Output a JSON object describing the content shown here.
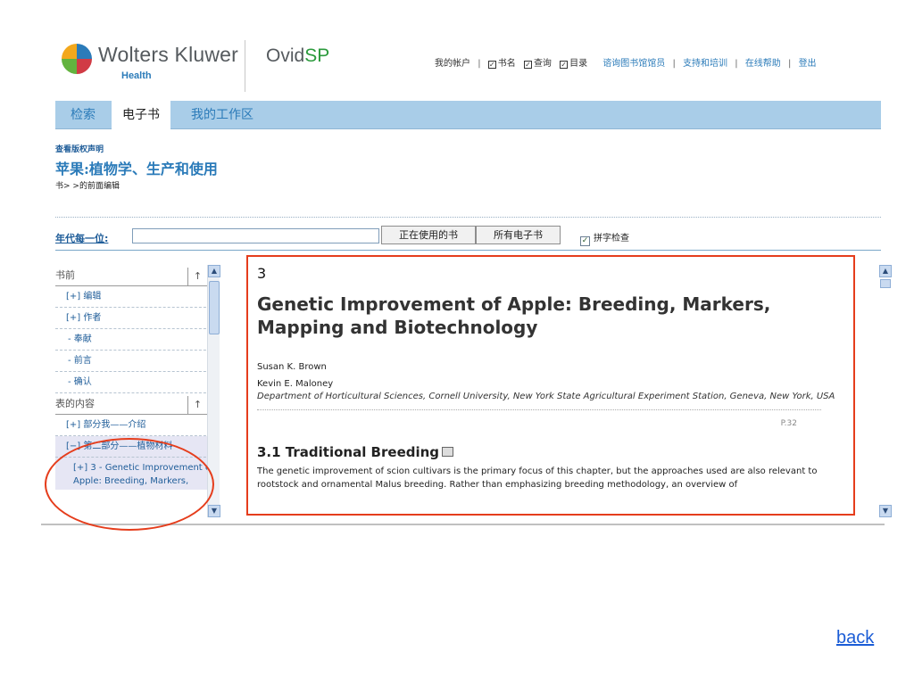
{
  "header": {
    "logo_text": "Wolters Kluwer",
    "logo_sub": "Health",
    "ovid_prefix": "Ovid",
    "ovid_suffix": "SP",
    "links": {
      "my_account": "我的帐户",
      "book_name": "书名",
      "query": "查询",
      "toc": "目录",
      "ask_librarian": "谘询图书馆馆员",
      "support": "支持和培训",
      "online_help": "在线帮助",
      "logout": "登出"
    }
  },
  "tabs": [
    {
      "label": "检索"
    },
    {
      "label": "电子书"
    },
    {
      "label": "我的工作区"
    }
  ],
  "page": {
    "copyright_link": "查看版权声明",
    "book_title": "苹果:植物学、生产和使用",
    "breadcrumb": "书> >的前面编辑"
  },
  "find": {
    "label": "年代每一位:",
    "value": "",
    "btn_current": "正在使用的书",
    "btn_all": "所有电子书",
    "spell_label": "拼字检查"
  },
  "sidebar": {
    "section_front": "书前",
    "up_arrow": "↑",
    "items": [
      {
        "label": "[+] 编辑"
      },
      {
        "label": "[+] 作者"
      },
      {
        "label": "- 奉献"
      },
      {
        "label": "- 前言"
      },
      {
        "label": "- 确认"
      }
    ],
    "section_toc": "表的内容",
    "toc_items": [
      {
        "label": "[+] 部分我——介绍"
      },
      {
        "label": "[−] 第二部分——植物材料"
      },
      {
        "label": "[+] 3 - Genetic Improvement of Apple: Breeding, Markers,"
      }
    ]
  },
  "content": {
    "chapter_number": "3",
    "chapter_title": "Genetic Improvement of Apple: Breeding, Markers, Mapping and Biotechnology",
    "author1": "Susan K. Brown",
    "author2": "Kevin E. Maloney",
    "affiliation": "Department of Horticultural Sciences, Cornell University, New York State Agricultural Experiment Station, Geneva, New York, USA",
    "page_marker": "P.32",
    "section_title": "3.1 Traditional Breeding",
    "paragraph": "The genetic improvement of scion cultivars is the primary focus of this chapter, but the approaches used are also relevant to rootstock and ornamental Malus breeding. Rather than emphasizing breeding methodology, an overview of"
  },
  "back_link": "back",
  "colors": {
    "tab_bar": "#a9cde8",
    "link_blue": "#2b7bb9",
    "annotation_red": "#e53d1c"
  }
}
